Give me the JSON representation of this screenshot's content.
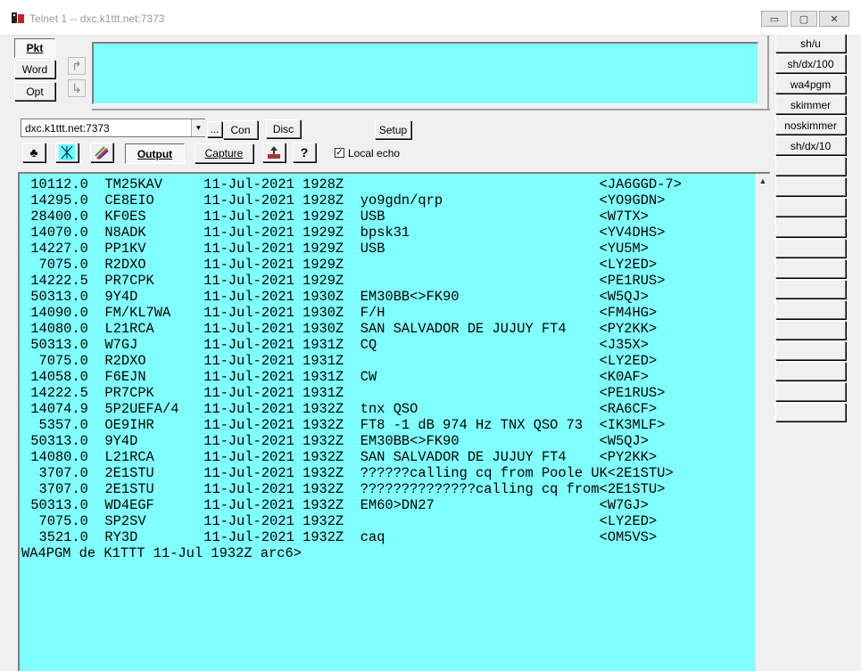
{
  "window": {
    "title": "Telnet 1 -- dxc.k1ttt.net:7373",
    "minimize_label": "▭",
    "maximize_label": "▢",
    "close_label": "✕"
  },
  "left_tabs": {
    "pkt": "Pkt",
    "word": "Word",
    "opt": "Opt"
  },
  "connection": {
    "host_value": "dxc.k1ttt.net:7373",
    "browse_label": "...",
    "connect_label": "Con",
    "disconnect_label": "Disc",
    "setup_label": "Setup"
  },
  "toolbar": {
    "output_label": "Output",
    "capture_label": "Capture",
    "local_echo_label": "Local echo",
    "local_echo_checked": true
  },
  "output": {
    "spots": [
      {
        "freq": "10112.0",
        "call": "TM25KAV",
        "date": "11-Jul-2021",
        "time": "1928Z",
        "comment": "",
        "spotter": "<JA6GGD-7>"
      },
      {
        "freq": "14295.0",
        "call": "CE8EIO",
        "date": "11-Jul-2021",
        "time": "1928Z",
        "comment": "yo9gdn/qrp",
        "spotter": "<YO9GDN>"
      },
      {
        "freq": "28400.0",
        "call": "KF0ES",
        "date": "11-Jul-2021",
        "time": "1929Z",
        "comment": "USB",
        "spotter": "<W7TX>"
      },
      {
        "freq": "14070.0",
        "call": "N8ADK",
        "date": "11-Jul-2021",
        "time": "1929Z",
        "comment": "bpsk31",
        "spotter": "<YV4DHS>"
      },
      {
        "freq": "14227.0",
        "call": "PP1KV",
        "date": "11-Jul-2021",
        "time": "1929Z",
        "comment": "USB",
        "spotter": "<YU5M>"
      },
      {
        "freq": "7075.0",
        "call": "R2DXO",
        "date": "11-Jul-2021",
        "time": "1929Z",
        "comment": "",
        "spotter": "<LY2ED>"
      },
      {
        "freq": "14222.5",
        "call": "PR7CPK",
        "date": "11-Jul-2021",
        "time": "1929Z",
        "comment": "",
        "spotter": "<PE1RUS>"
      },
      {
        "freq": "50313.0",
        "call": "9Y4D",
        "date": "11-Jul-2021",
        "time": "1930Z",
        "comment": "EM30BB<>FK90",
        "spotter": "<W5QJ>"
      },
      {
        "freq": "14090.0",
        "call": "FM/KL7WA",
        "date": "11-Jul-2021",
        "time": "1930Z",
        "comment": "F/H",
        "spotter": "<FM4HG>"
      },
      {
        "freq": "14080.0",
        "call": "L21RCA",
        "date": "11-Jul-2021",
        "time": "1930Z",
        "comment": "SAN SALVADOR DE JUJUY FT4",
        "spotter": "<PY2KK>"
      },
      {
        "freq": "50313.0",
        "call": "W7GJ",
        "date": "11-Jul-2021",
        "time": "1931Z",
        "comment": "CQ",
        "spotter": "<J35X>"
      },
      {
        "freq": "7075.0",
        "call": "R2DXO",
        "date": "11-Jul-2021",
        "time": "1931Z",
        "comment": "",
        "spotter": "<LY2ED>"
      },
      {
        "freq": "14058.0",
        "call": "F6EJN",
        "date": "11-Jul-2021",
        "time": "1931Z",
        "comment": "CW",
        "spotter": "<K0AF>"
      },
      {
        "freq": "14222.5",
        "call": "PR7CPK",
        "date": "11-Jul-2021",
        "time": "1931Z",
        "comment": "",
        "spotter": "<PE1RUS>"
      },
      {
        "freq": "14074.9",
        "call": "5P2UEFA/4",
        "date": "11-Jul-2021",
        "time": "1932Z",
        "comment": "tnx QSO",
        "spotter": "<RA6CF>"
      },
      {
        "freq": "5357.0",
        "call": "OE9IHR",
        "date": "11-Jul-2021",
        "time": "1932Z",
        "comment": "FT8 -1 dB 974 Hz TNX QSO 73",
        "spotter": "<IK3MLF>"
      },
      {
        "freq": "50313.0",
        "call": "9Y4D",
        "date": "11-Jul-2021",
        "time": "1932Z",
        "comment": "EM30BB<>FK90",
        "spotter": "<W5QJ>"
      },
      {
        "freq": "14080.0",
        "call": "L21RCA",
        "date": "11-Jul-2021",
        "time": "1932Z",
        "comment": "SAN SALVADOR DE JUJUY FT4",
        "spotter": "<PY2KK>"
      },
      {
        "freq": "3707.0",
        "call": "2E1STU",
        "date": "11-Jul-2021",
        "time": "1932Z",
        "comment": "??????calling cq from Poole UK",
        "spotter": "<2E1STU>"
      },
      {
        "freq": "3707.0",
        "call": "2E1STU",
        "date": "11-Jul-2021",
        "time": "1932Z",
        "comment": "??????????????calling cq from",
        "spotter": "<2E1STU>"
      },
      {
        "freq": "50313.0",
        "call": "WD4EGF",
        "date": "11-Jul-2021",
        "time": "1932Z",
        "comment": "EM60>DN27",
        "spotter": "<W7GJ>"
      },
      {
        "freq": "7075.0",
        "call": "SP2SV",
        "date": "11-Jul-2021",
        "time": "1932Z",
        "comment": "",
        "spotter": "<LY2ED>"
      },
      {
        "freq": "3521.0",
        "call": "RY3D",
        "date": "11-Jul-2021",
        "time": "1932Z",
        "comment": "caq",
        "spotter": "<OM5VS>"
      }
    ],
    "prompt": "WA4PGM de K1TTT 11-Jul 1932Z arc6>"
  },
  "macros": [
    "sh/u",
    "sh/dx/100",
    "wa4pgm",
    "skimmer",
    "noskimmer",
    "sh/dx/10",
    "",
    "",
    "",
    "",
    "",
    "",
    "",
    "",
    "",
    "",
    "",
    "",
    ""
  ]
}
